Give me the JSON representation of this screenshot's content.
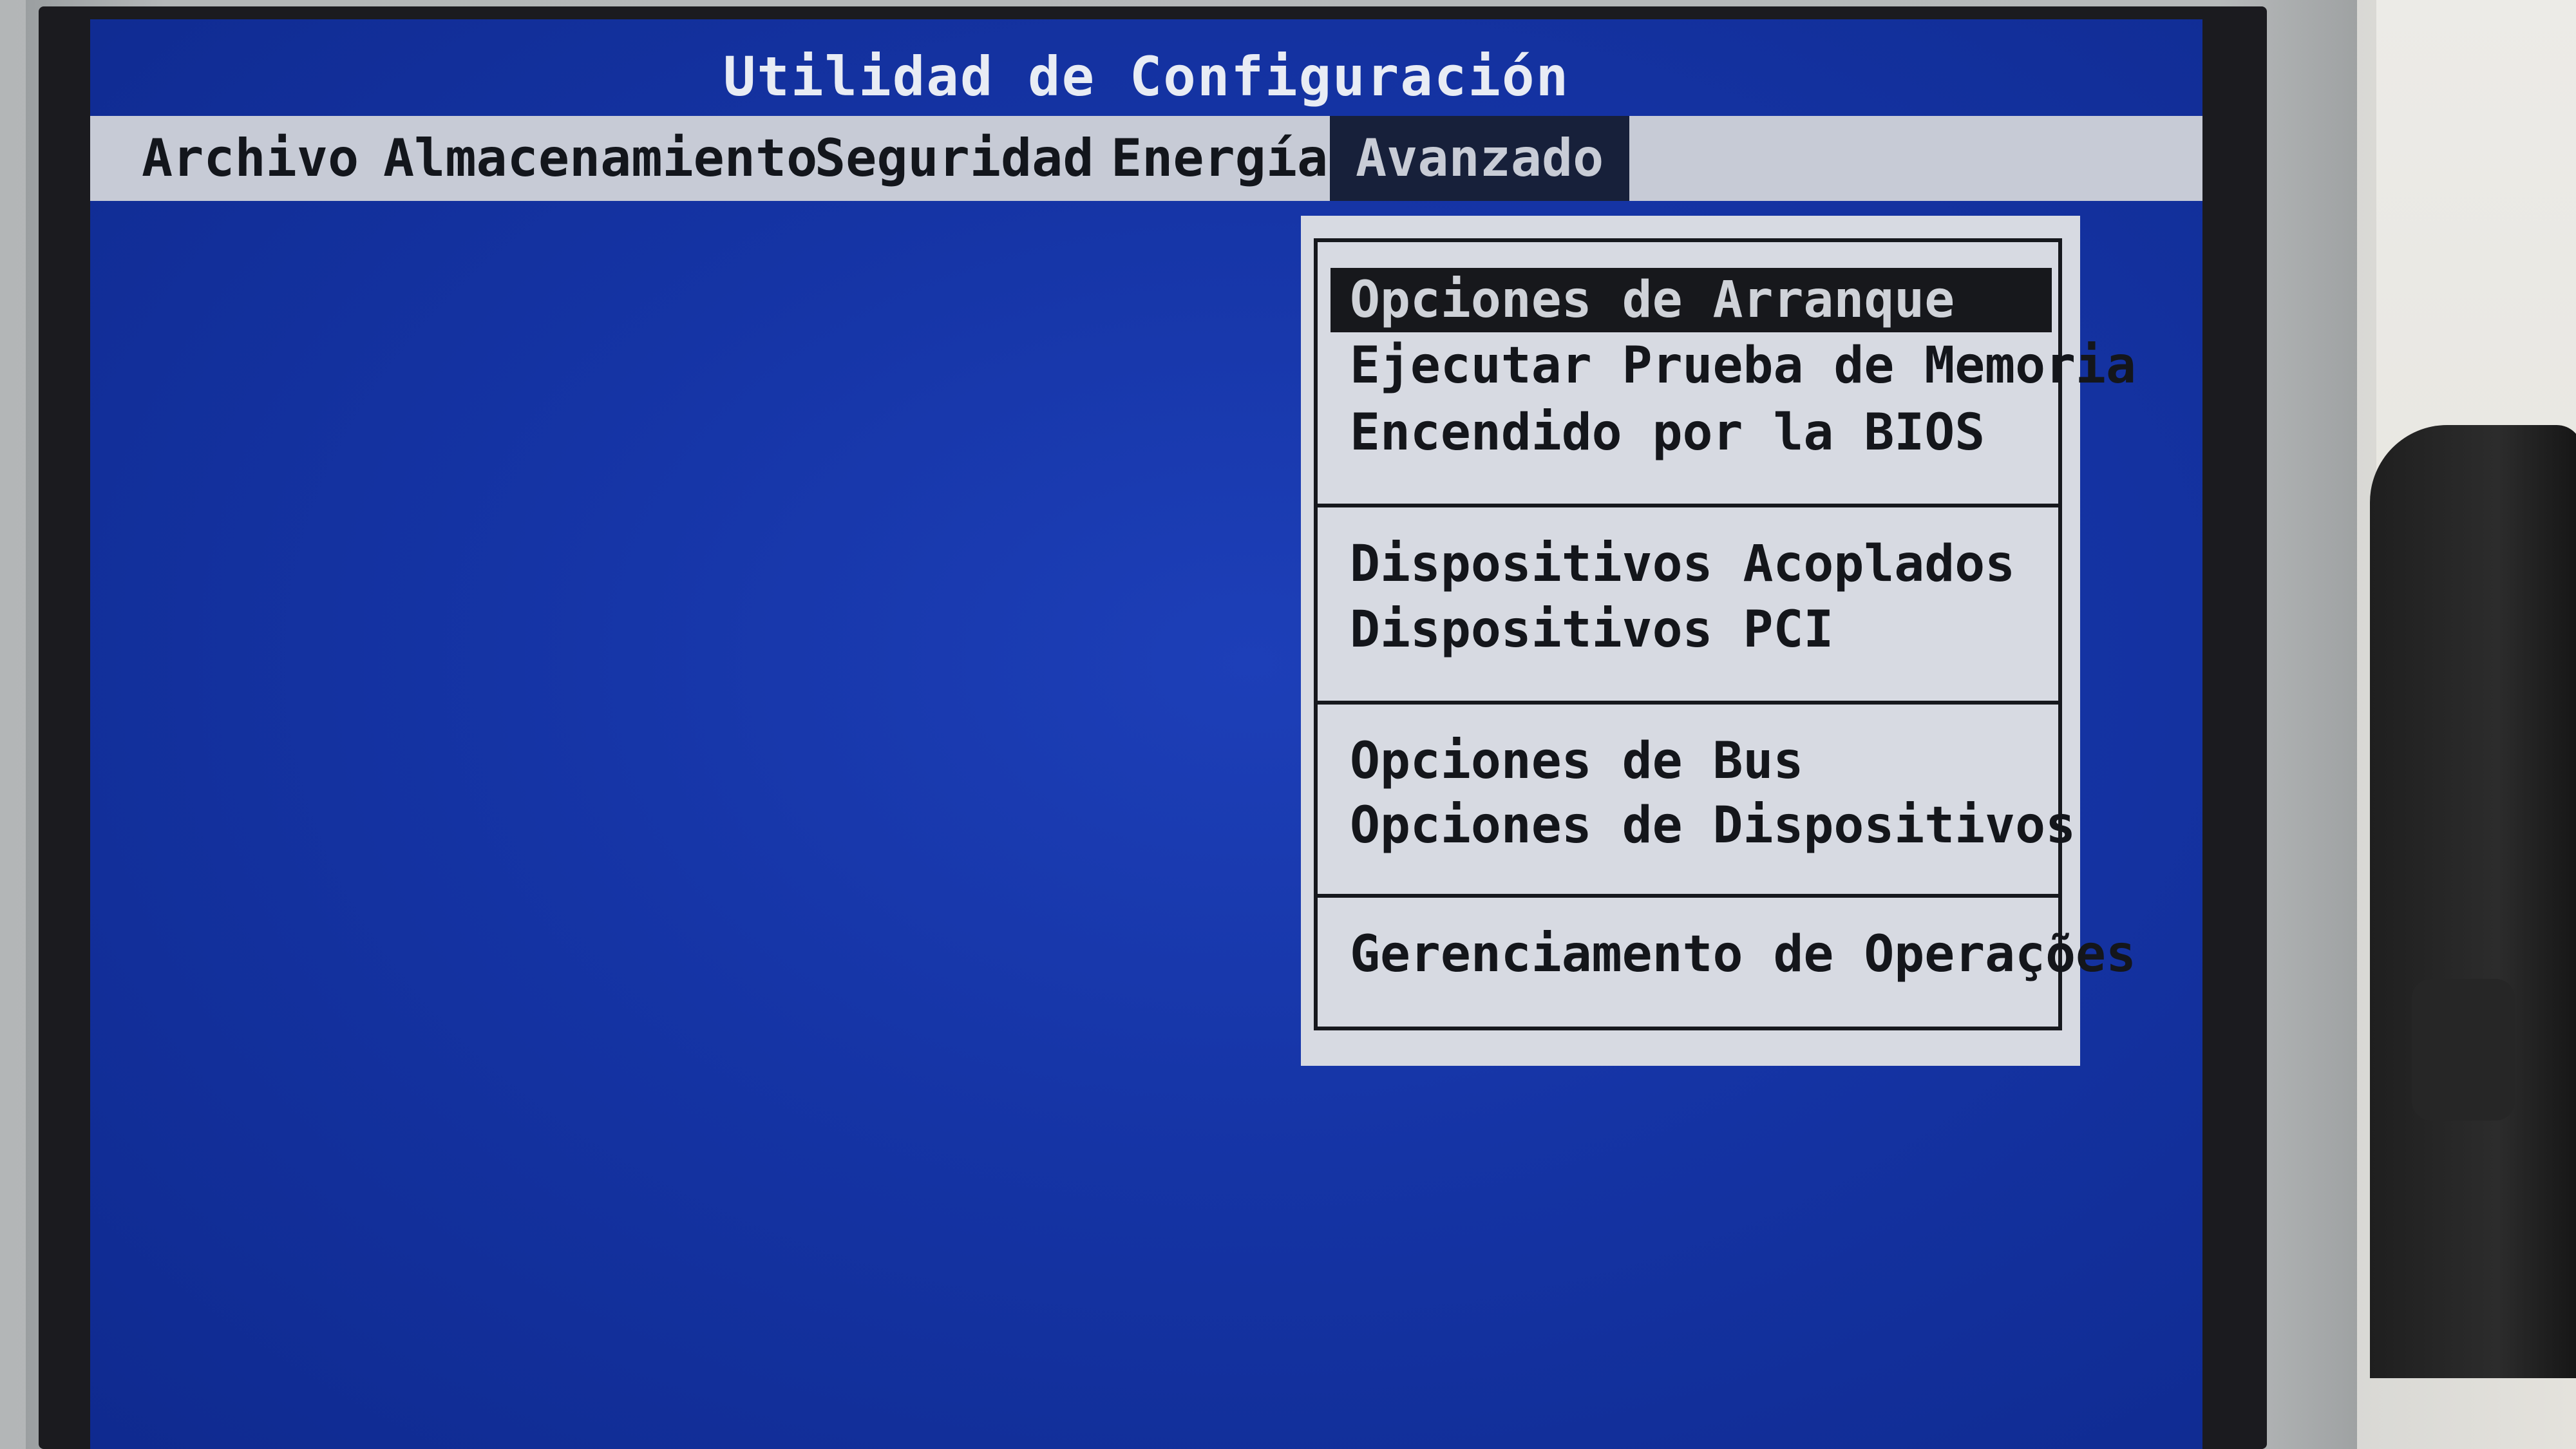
{
  "window": {
    "title": "Utilidad de Configuración"
  },
  "menubar": {
    "items": [
      {
        "label": "Archivo",
        "active": false
      },
      {
        "label": "Almacenamiento",
        "active": false
      },
      {
        "label": "Seguridad",
        "active": false
      },
      {
        "label": "Energía",
        "active": false
      },
      {
        "label": "Avanzado",
        "active": true
      }
    ]
  },
  "dropdown": {
    "groups": [
      {
        "items": [
          {
            "label": "Opciones de Arranque",
            "selected": true
          },
          {
            "label": "Ejecutar Prueba de Memoria",
            "selected": false
          },
          {
            "label": "Encendido por la BIOS",
            "selected": false
          }
        ]
      },
      {
        "items": [
          {
            "label": "Dispositivos Acoplados",
            "selected": false
          },
          {
            "label": "Dispositivos PCI",
            "selected": false
          }
        ]
      },
      {
        "items": [
          {
            "label": "Opciones de Bus",
            "selected": false
          },
          {
            "label": "Opciones de Dispositivos",
            "selected": false
          }
        ]
      },
      {
        "items": [
          {
            "label": "Gerenciamento de Operações",
            "selected": false
          }
        ]
      }
    ]
  },
  "colors": {
    "screen_background": "#1534a5",
    "menubar_background": "#c7cbd6",
    "highlight": "#17181c",
    "dropdown_background": "#d7dae2"
  }
}
